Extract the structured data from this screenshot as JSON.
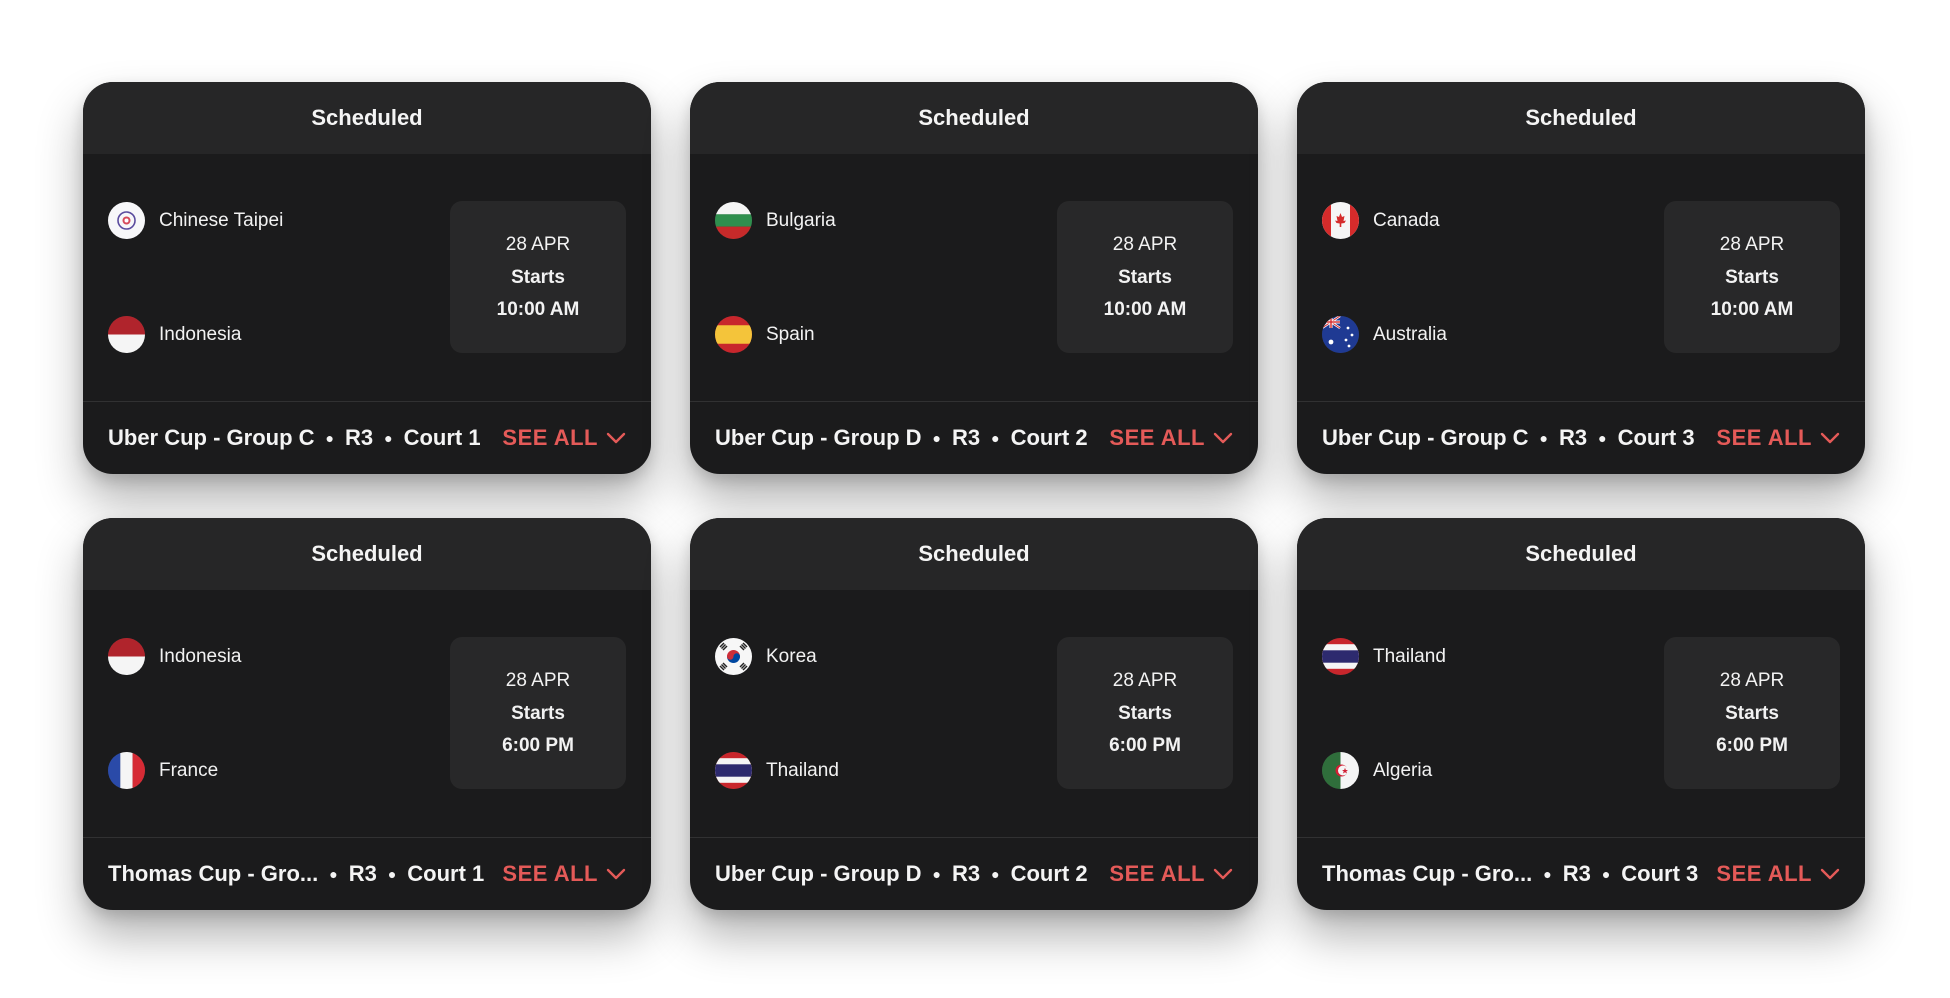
{
  "colors": {
    "card_bg": "#1b1b1c",
    "header_bg": "#262627",
    "time_box_bg": "#282829",
    "accent": "#e45a58",
    "text": "#f4f4f4"
  },
  "matches": [
    {
      "status": "Scheduled",
      "team1": {
        "name": "Chinese Taipei",
        "flag_icon": "chinese-taipei-flag-icon"
      },
      "team2": {
        "name": "Indonesia",
        "flag_icon": "indonesia-flag-icon"
      },
      "date": "28 APR",
      "starts_label": "Starts",
      "time": "10:00 AM",
      "competition": "Uber Cup - Group C",
      "round": "R3",
      "court": "Court 1",
      "see_all_label": "SEE ALL"
    },
    {
      "status": "Scheduled",
      "team1": {
        "name": "Bulgaria",
        "flag_icon": "bulgaria-flag-icon"
      },
      "team2": {
        "name": "Spain",
        "flag_icon": "spain-flag-icon"
      },
      "date": "28 APR",
      "starts_label": "Starts",
      "time": "10:00 AM",
      "competition": "Uber Cup - Group D",
      "round": "R3",
      "court": "Court 2",
      "see_all_label": "SEE ALL"
    },
    {
      "status": "Scheduled",
      "team1": {
        "name": "Canada",
        "flag_icon": "canada-flag-icon"
      },
      "team2": {
        "name": "Australia",
        "flag_icon": "australia-flag-icon"
      },
      "date": "28 APR",
      "starts_label": "Starts",
      "time": "10:00 AM",
      "competition": "Uber Cup - Group C",
      "round": "R3",
      "court": "Court 3",
      "see_all_label": "SEE ALL"
    },
    {
      "status": "Scheduled",
      "team1": {
        "name": "Indonesia",
        "flag_icon": "indonesia-flag-icon"
      },
      "team2": {
        "name": "France",
        "flag_icon": "france-flag-icon"
      },
      "date": "28 APR",
      "starts_label": "Starts",
      "time": "6:00 PM",
      "competition": "Thomas Cup - Gro...",
      "round": "R3",
      "court": "Court 1",
      "see_all_label": "SEE ALL"
    },
    {
      "status": "Scheduled",
      "team1": {
        "name": "Korea",
        "flag_icon": "korea-flag-icon"
      },
      "team2": {
        "name": "Thailand",
        "flag_icon": "thailand-flag-icon"
      },
      "date": "28 APR",
      "starts_label": "Starts",
      "time": "6:00 PM",
      "competition": "Uber Cup - Group D",
      "round": "R3",
      "court": "Court 2",
      "see_all_label": "SEE ALL"
    },
    {
      "status": "Scheduled",
      "team1": {
        "name": "Thailand",
        "flag_icon": "thailand-flag-icon"
      },
      "team2": {
        "name": "Algeria",
        "flag_icon": "algeria-flag-icon"
      },
      "date": "28 APR",
      "starts_label": "Starts",
      "time": "6:00 PM",
      "competition": "Thomas Cup - Gro...",
      "round": "R3",
      "court": "Court 3",
      "see_all_label": "SEE ALL"
    }
  ]
}
